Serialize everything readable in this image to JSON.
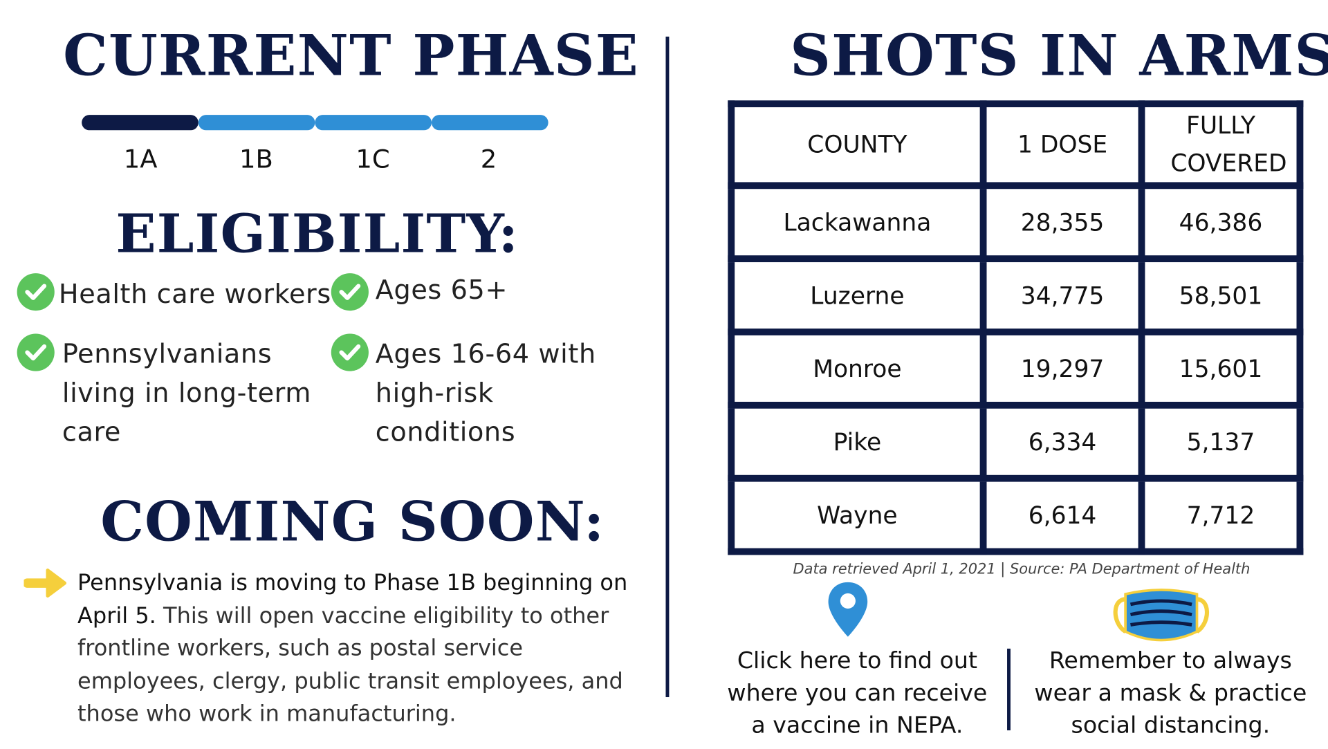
{
  "current_phase": {
    "title": "CURRENT PHASE",
    "phases": [
      "1A",
      "1B",
      "1C",
      "2"
    ],
    "active_phase": "1A",
    "colors": {
      "active": "#0d1a45",
      "inactive": "#2f8fd6"
    }
  },
  "eligibility": {
    "title": "ELIGIBILITY:",
    "items": [
      {
        "icon": "check-circle-icon",
        "text": "Health care workers"
      },
      {
        "icon": "check-circle-icon",
        "text": "Ages 65+"
      },
      {
        "icon": "check-circle-icon",
        "lines": [
          "Pennsylvanians",
          "living in long-term",
          "care"
        ]
      },
      {
        "icon": "check-circle-icon",
        "lines": [
          "Ages 16-64 with",
          "high-risk",
          "conditions"
        ]
      }
    ]
  },
  "coming_soon": {
    "title": "COMING SOON:",
    "icon": "arrow-right-icon",
    "lead": "Pennsylvania is moving to Phase 1B beginning on April 5.",
    "body": " This will open vaccine eligibility to other frontline workers, such as postal service employees, clergy, public transit employees, and those who work in manufacturing."
  },
  "shots": {
    "title": "SHOTS IN ARMS:",
    "columns": [
      "COUNTY",
      "1 DOSE",
      "FULLY COVERED"
    ],
    "rows": [
      [
        "Lackawanna",
        "28,355",
        "46,386"
      ],
      [
        "Luzerne",
        "34,775",
        "58,501"
      ],
      [
        "Monroe",
        "19,297",
        "15,601"
      ],
      [
        "Pike",
        "6,334",
        "5,137"
      ],
      [
        "Wayne",
        "6,614",
        "7,712"
      ]
    ],
    "source": "Data retrieved April 1, 2021 | Source: PA Department of Health"
  },
  "footer": {
    "locator_icon": "map-pin-icon",
    "locator_text": "Click here to find out where you can receive a vaccine in NEPA.",
    "mask_icon": "face-mask-icon",
    "mask_text": "Remember to always wear a mask & practice social distancing."
  },
  "colors": {
    "navy": "#0d1a45",
    "blue": "#2f8fd6",
    "green": "#5cc45c",
    "yellow": "#f5cf3c"
  }
}
